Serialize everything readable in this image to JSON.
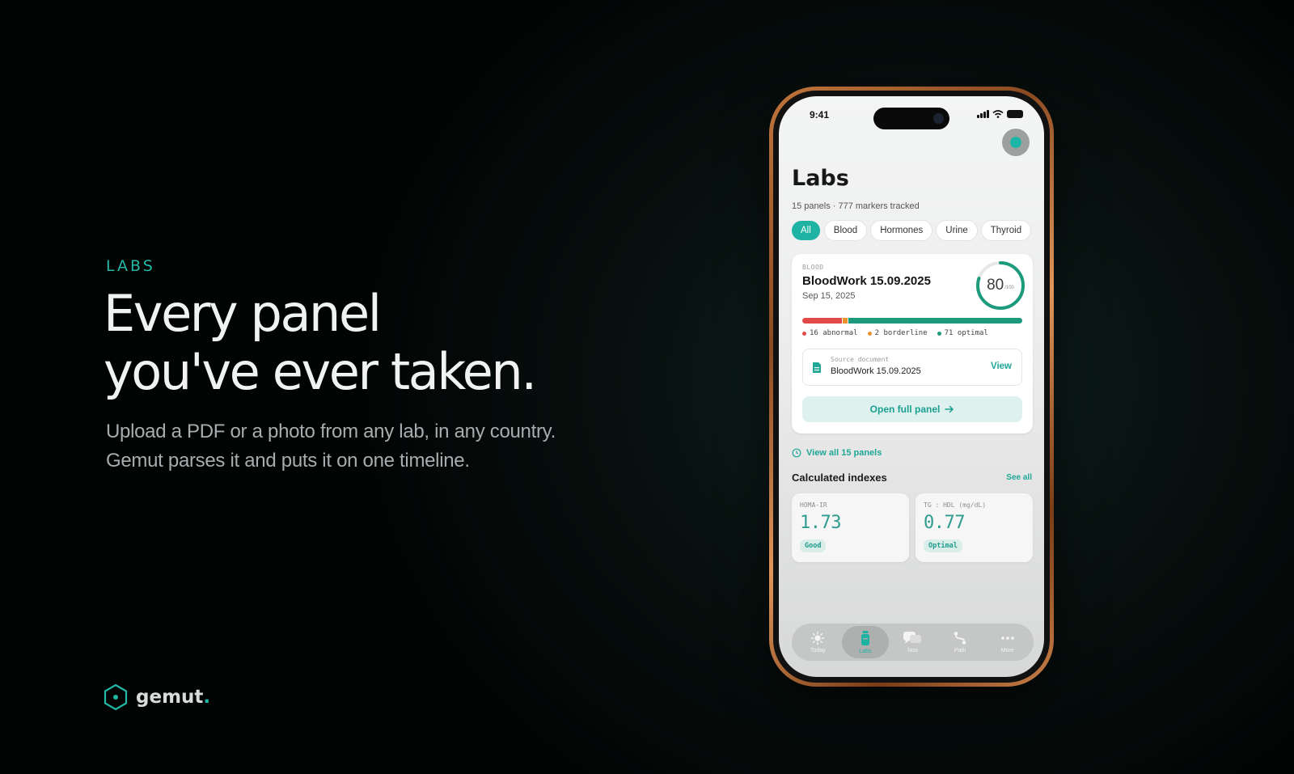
{
  "marketing": {
    "eyebrow": "LABS",
    "headline_line1": "Every panel",
    "headline_line2": "you've ever taken.",
    "sub_line1": "Upload a PDF or a photo from any lab, in any country.",
    "sub_line2": "Gemut parses it and puts it on one timeline."
  },
  "brand": {
    "name": "gemut",
    "dot": ".",
    "accent": "#22b8a6"
  },
  "status_bar": {
    "time": "9:41"
  },
  "screen": {
    "title": "Labs",
    "meta": "15 panels · 777 markers tracked",
    "filters": [
      "All",
      "Blood",
      "Hormones",
      "Urine",
      "Thyroid"
    ],
    "active_filter": "All"
  },
  "panel_card": {
    "category": "BLOOD",
    "title": "BloodWork 15.09.2025",
    "date": "Sep 15, 2025",
    "score": "80",
    "score_max": "/100",
    "score_fraction": 0.8,
    "counts": {
      "abnormal": 16,
      "borderline": 2,
      "optimal": 71
    },
    "legend_abnormal": "16 abnormal",
    "legend_borderline": "2 borderline",
    "legend_optimal": "71 optimal",
    "colors": {
      "abnormal": "#e24a4a",
      "borderline": "#e7922c",
      "optimal": "#1d9a7c"
    },
    "source_label": "Source document",
    "source_name": "BloodWork 15.09.2025",
    "view_label": "View",
    "open_label": "Open full panel"
  },
  "view_all_label": "View all 15 panels",
  "indexes": {
    "title": "Calculated indexes",
    "see_all": "See all",
    "items": [
      {
        "name": "HOMA-IR",
        "value": "1.73",
        "badge": "Good"
      },
      {
        "name": "TG : HDL (mg/dL)",
        "value": "0.77",
        "badge": "Optimal"
      }
    ]
  },
  "tabbar": {
    "items": [
      {
        "label": "Today",
        "icon": "sun-icon"
      },
      {
        "label": "Labs",
        "icon": "vial-icon"
      },
      {
        "label": "Noa",
        "icon": "chat-icon"
      },
      {
        "label": "Path",
        "icon": "path-icon"
      },
      {
        "label": "More",
        "icon": "more-icon"
      }
    ],
    "active": "Labs"
  }
}
